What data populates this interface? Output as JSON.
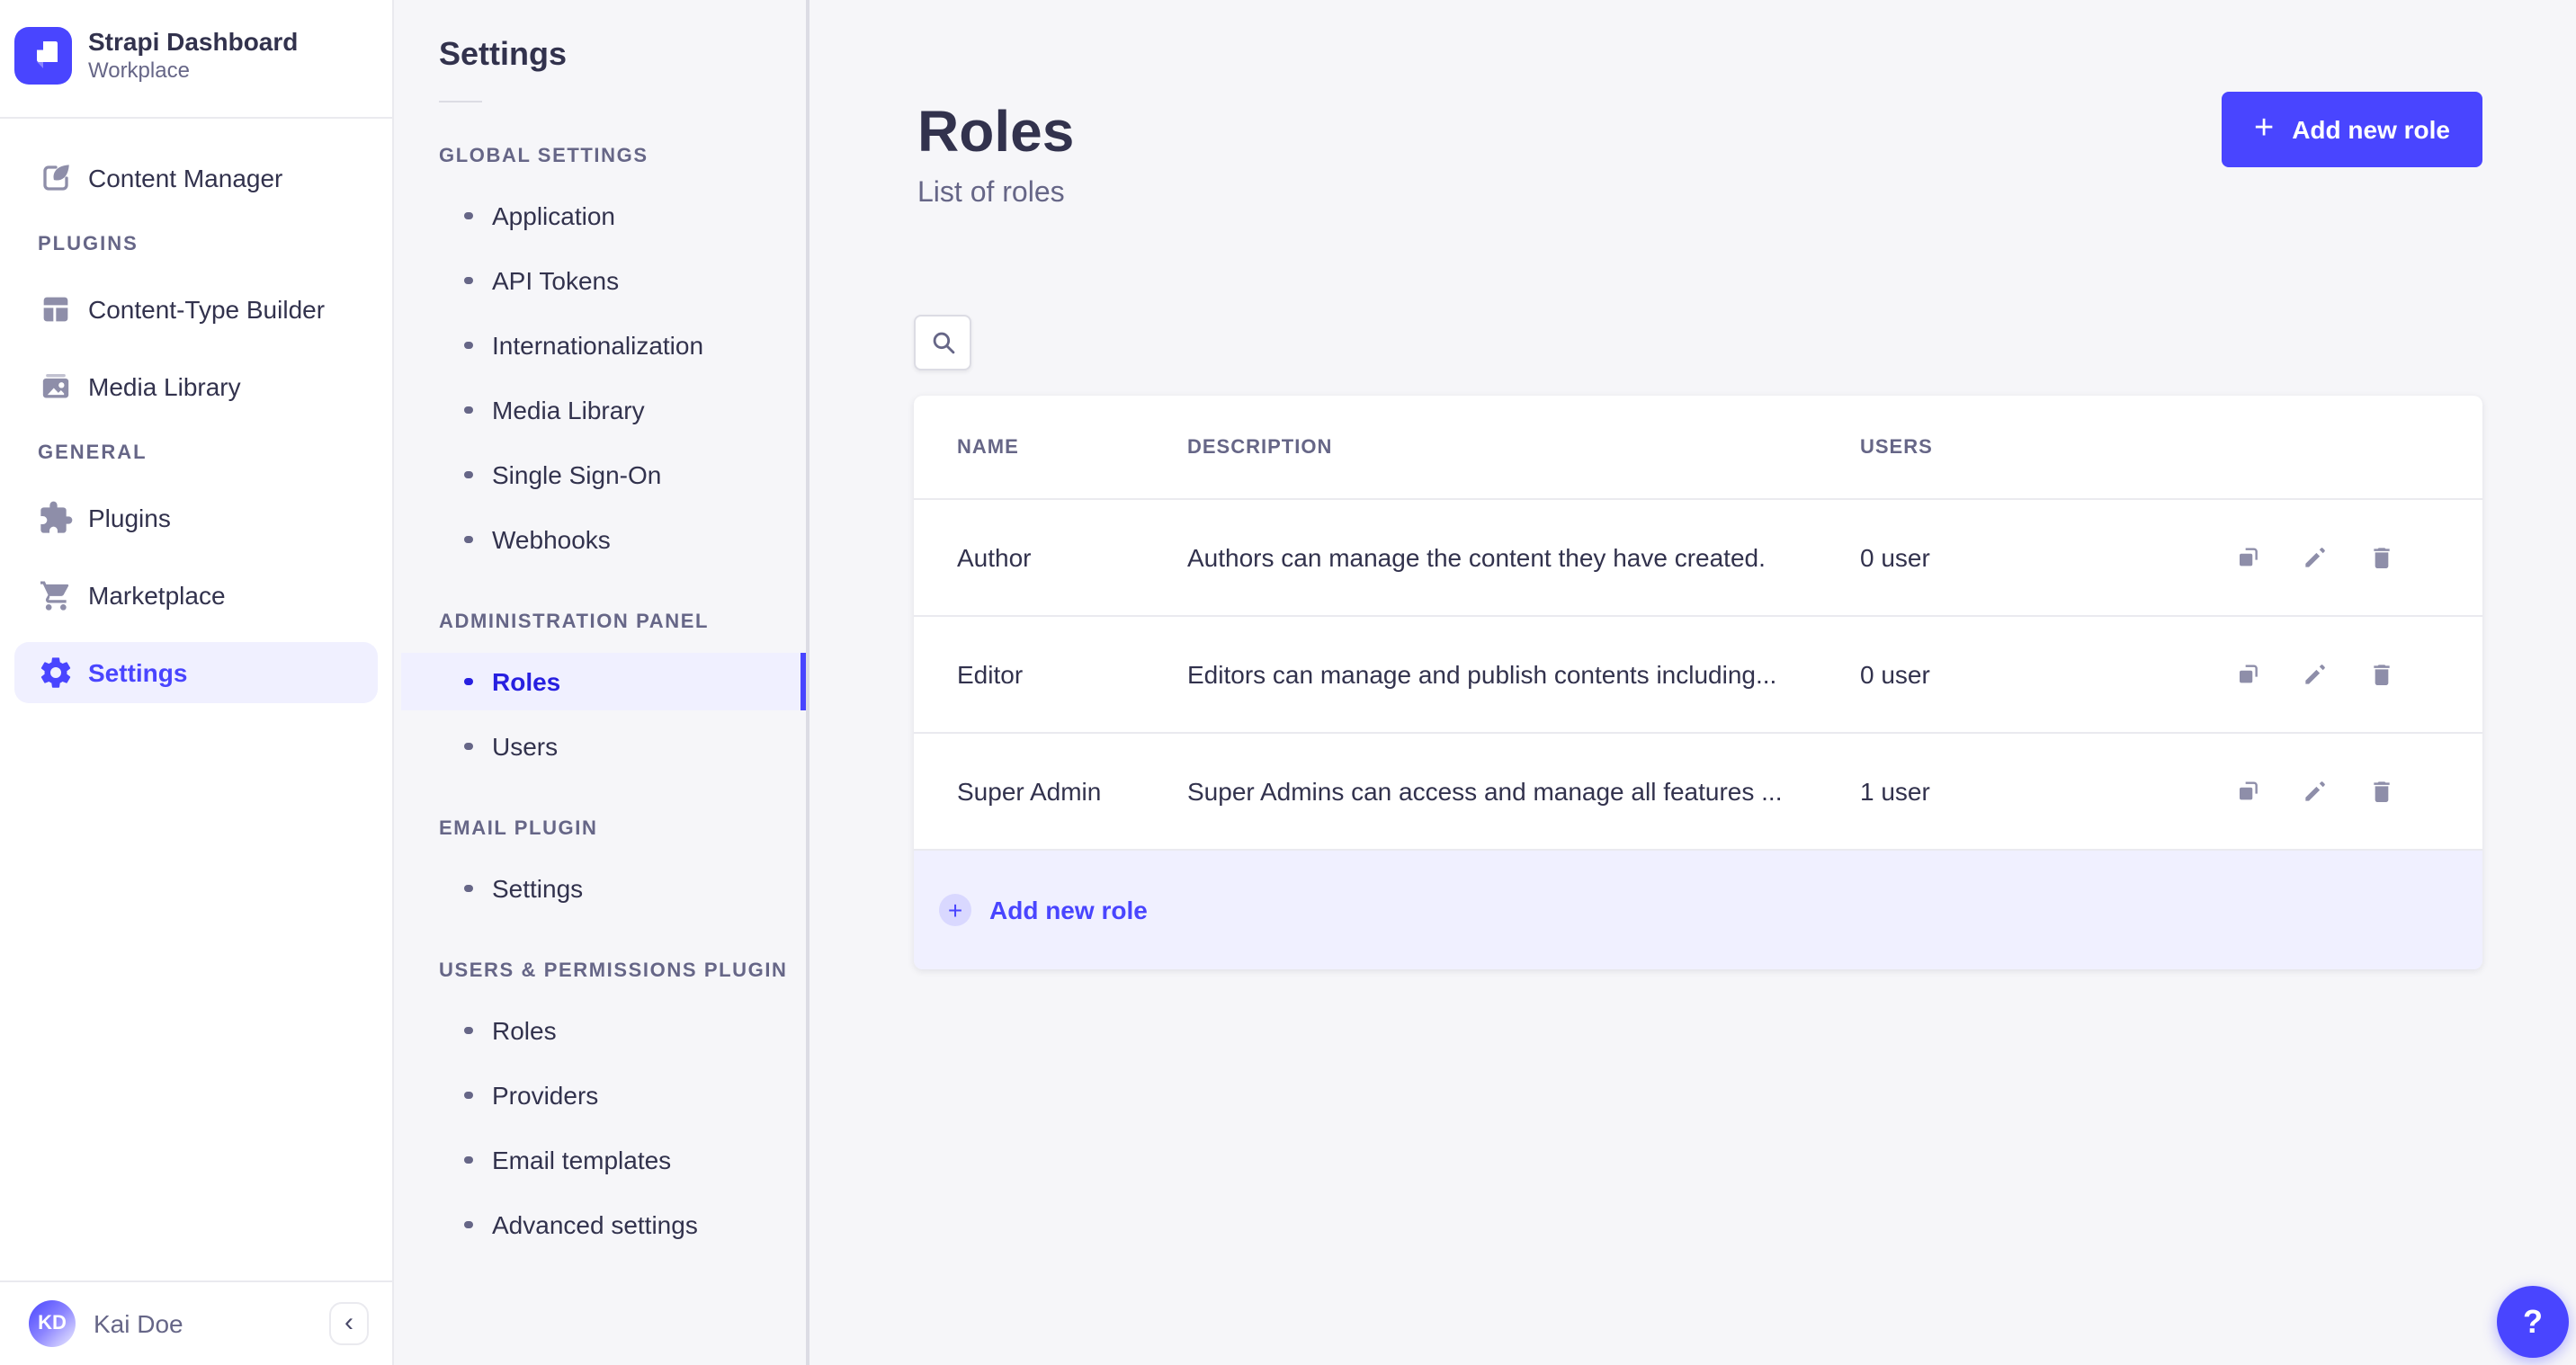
{
  "colors": {
    "accent": "#4945ff",
    "accent_active_text": "#271fe0",
    "accent_bg": "#f0f0ff",
    "accent_chip": "#d9d8ff",
    "text_dark": "#32324d",
    "text_muted": "#666687",
    "icon_gray": "#8e8ea9",
    "border": "#eaeaef",
    "panel_bg": "#f6f6f9"
  },
  "icons": {
    "plus": "+",
    "chevron_left": "‹",
    "help": "?"
  },
  "brand": {
    "name": "Strapi Dashboard",
    "workspace": "Workplace"
  },
  "sidebar": {
    "content_manager": {
      "label": "Content Manager"
    },
    "sections": [
      {
        "header": "PLUGINS",
        "items": [
          {
            "label": "Content-Type Builder"
          },
          {
            "label": "Media Library"
          }
        ]
      },
      {
        "header": "GENERAL",
        "items": [
          {
            "label": "Plugins"
          },
          {
            "label": "Marketplace"
          },
          {
            "label": "Settings",
            "active": true
          }
        ]
      }
    ],
    "user": {
      "initials": "KD",
      "name": "Kai Doe"
    }
  },
  "subnav": {
    "title": "Settings",
    "sections": [
      {
        "header": "GLOBAL SETTINGS",
        "items": [
          {
            "label": "Application"
          },
          {
            "label": "API Tokens"
          },
          {
            "label": "Internationalization"
          },
          {
            "label": "Media Library"
          },
          {
            "label": "Single Sign-On"
          },
          {
            "label": "Webhooks"
          }
        ]
      },
      {
        "header": "ADMINISTRATION PANEL",
        "items": [
          {
            "label": "Roles",
            "active": true
          },
          {
            "label": "Users"
          }
        ]
      },
      {
        "header": "EMAIL PLUGIN",
        "items": [
          {
            "label": "Settings"
          }
        ]
      },
      {
        "header": "USERS & PERMISSIONS PLUGIN",
        "items": [
          {
            "label": "Roles"
          },
          {
            "label": "Providers"
          },
          {
            "label": "Email templates"
          },
          {
            "label": "Advanced settings"
          }
        ]
      }
    ]
  },
  "main": {
    "title": "Roles",
    "subtitle": "List of roles",
    "add_button_label": "Add new role",
    "table": {
      "columns": [
        "NAME",
        "DESCRIPTION",
        "USERS"
      ],
      "rows": [
        {
          "name": "Author",
          "description": "Authors can manage the content they have created.",
          "users": "0 user"
        },
        {
          "name": "Editor",
          "description": "Editors can manage and publish contents including...",
          "users": "0 user"
        },
        {
          "name": "Super Admin",
          "description": "Super Admins can access and manage all features ...",
          "users": "1 user"
        }
      ],
      "footer_label": "Add new role"
    }
  }
}
